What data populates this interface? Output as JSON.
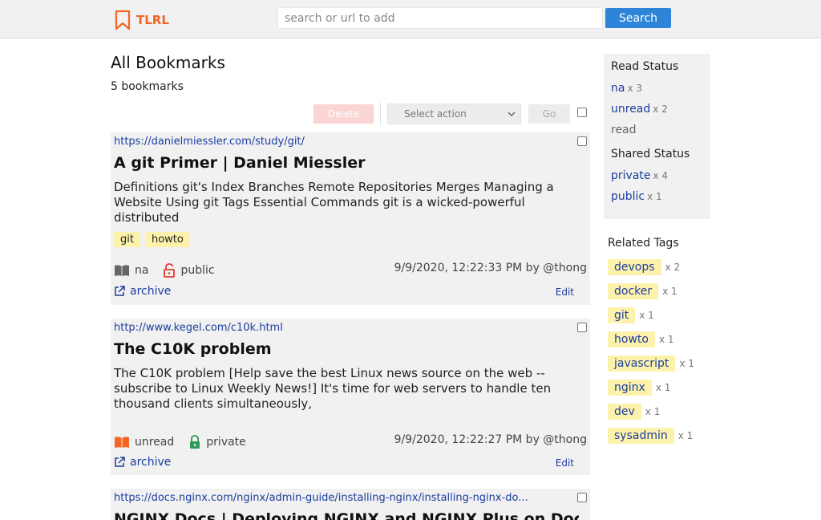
{
  "header": {
    "logo_text": "TLRL",
    "search_placeholder": "search or url to add",
    "search_button": "Search"
  },
  "page": {
    "title": "All Bookmarks",
    "count": "5 bookmarks"
  },
  "toolbar": {
    "delete_label": "Delete",
    "action_placeholder": "Select action",
    "go_label": "Go"
  },
  "bookmarks": [
    {
      "url": "https://danielmiessler.com/study/git/",
      "title": "A git Primer | Daniel Miessler",
      "description": "Definitions git's Index Branches Remote Repositories Merges Managing a Website Using git Tags Essential Commands git is a wicked-powerful distributed",
      "tags": [
        "git",
        "howto"
      ],
      "read_status": "na",
      "shared_status": "public",
      "timestamp": "9/9/2020, 12:22:33 PM by @thong",
      "archive_label": "archive",
      "edit_label": "Edit"
    },
    {
      "url": "http://www.kegel.com/c10k.html",
      "title": "The C10K problem",
      "description": "The C10K problem [Help save the best Linux news source on the web -- subscribe to Linux Weekly News!] It's time for web servers to handle ten thousand clients simultaneously,",
      "tags": [],
      "read_status": "unread",
      "shared_status": "private",
      "timestamp": "9/9/2020, 12:22:27 PM by @thong",
      "archive_label": "archive",
      "edit_label": "Edit"
    },
    {
      "url": "https://docs.nginx.com/nginx/admin-guide/installing-nginx/installing-nginx-do...",
      "title": "NGINX Docs | Deploying NGINX and NGINX Plus on Doc"
    }
  ],
  "sidebar": {
    "read_status_heading": "Read Status",
    "read_status": [
      {
        "label": "na",
        "count": "x 3"
      },
      {
        "label": "unread",
        "count": "x 2"
      },
      {
        "label": "read",
        "count": ""
      }
    ],
    "shared_status_heading": "Shared Status",
    "shared_status": [
      {
        "label": "private",
        "count": "x 4"
      },
      {
        "label": "public",
        "count": "x 1"
      }
    ],
    "related_tags_heading": "Related Tags",
    "related_tags": [
      {
        "label": "devops",
        "count": "x 2"
      },
      {
        "label": "docker",
        "count": "x 1"
      },
      {
        "label": "git",
        "count": "x 1"
      },
      {
        "label": "howto",
        "count": "x 1"
      },
      {
        "label": "javascript",
        "count": "x 1"
      },
      {
        "label": "nginx",
        "count": "x 1"
      },
      {
        "label": "dev",
        "count": "x 1"
      },
      {
        "label": "sysadmin",
        "count": "x 1"
      }
    ]
  },
  "colors": {
    "brand": "#f26522",
    "link": "#1a3d9e",
    "primary_button": "#2d84d8",
    "tag_bg": "#fdf2ac",
    "card_bg": "#f1f1f1",
    "public_icon": "#e53935",
    "private_icon": "#2e9a5a",
    "unread_icon": "#f26522",
    "na_icon": "#666666"
  }
}
